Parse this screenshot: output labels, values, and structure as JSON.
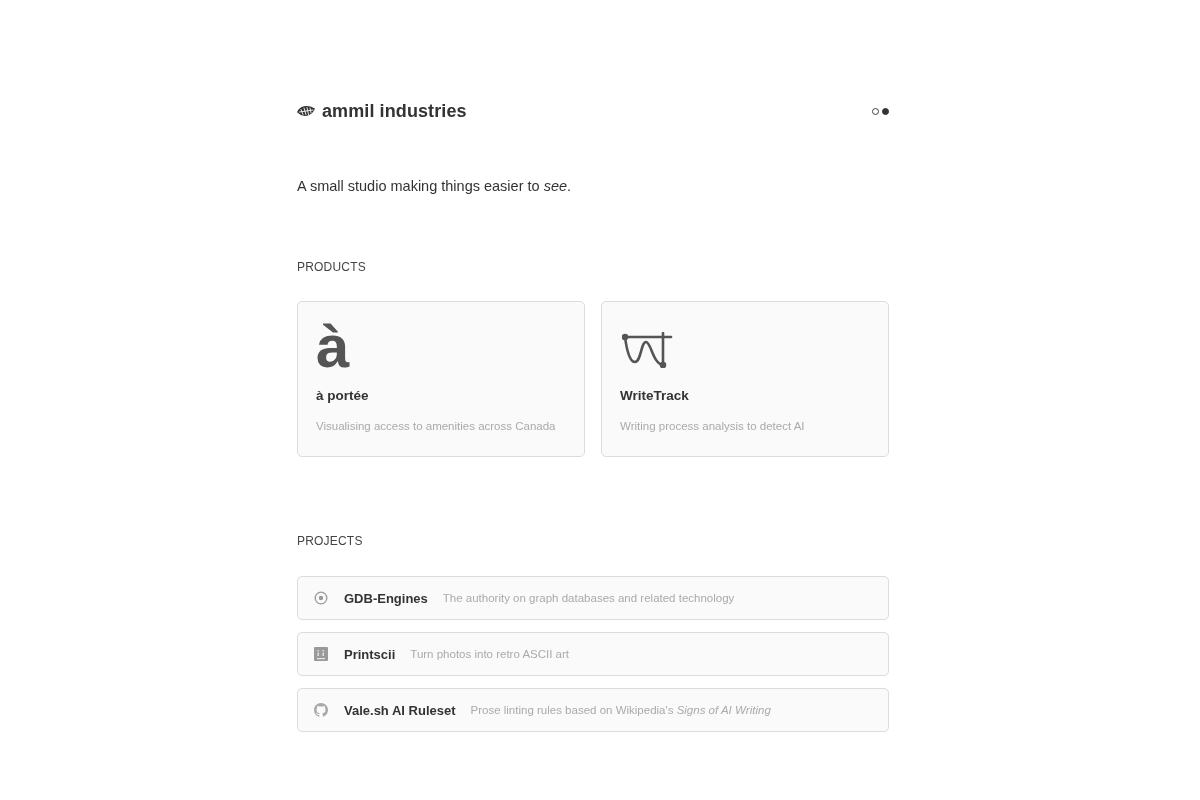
{
  "header": {
    "title": "ammil industries",
    "theme_toggle": [
      {
        "selected": false
      },
      {
        "selected": true
      }
    ]
  },
  "tagline": "A small studio making things easier to *see*.",
  "products": {
    "heading": "PRODUCTS",
    "items": [
      {
        "kind": "letter",
        "logo": "à",
        "name": "à portée",
        "description": "Visualising access to amenities across Canada"
      },
      {
        "kind": "drawing",
        "name": "WriteTrack",
        "description": "Writing process analysis to detect AI"
      }
    ]
  },
  "projects": {
    "heading": "PROJECTS",
    "items": [
      {
        "name": "GDB-Engines",
        "description": "The authority on graph databases and related technology"
      },
      {
        "name": "Printscii",
        "description": "Turn photos into retro ASCII art"
      },
      {
        "name": "Vale.sh AI Ruleset",
        "description": "Prose linting rules based on Wikipedia's *Signs of AI Writing*"
      }
    ]
  }
}
